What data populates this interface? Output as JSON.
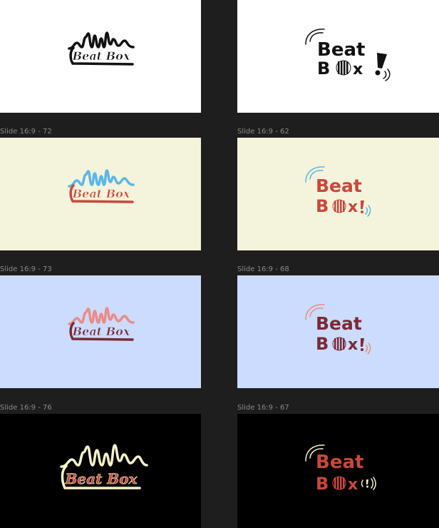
{
  "canvas": {
    "background": "#1e1e1e"
  },
  "frames": [
    {
      "id": "r1-left",
      "label": "",
      "bg": "#ffffff",
      "variant": "wave",
      "colors": {
        "wave": "#111111",
        "text": "#111111",
        "fill": "#111111",
        "line": "#111111"
      }
    },
    {
      "id": "r1-right",
      "label": "",
      "bg": "#ffffff",
      "variant": "beat",
      "colors": {
        "arc": "#111111",
        "text": "#111111",
        "ball": "#111111",
        "bang": "#111111",
        "waves": "#111111"
      }
    },
    {
      "id": "r2-left",
      "label": "Slide 16:9 - 72",
      "bg": "#f4f3dc",
      "variant": "wave",
      "colors": {
        "wave": "#5bb7e6",
        "text": "#c9483a",
        "fill": "#c9483a",
        "line": "#c9483a"
      }
    },
    {
      "id": "r2-right",
      "label": "Slide 16:9 - 62",
      "bg": "#f4f3dc",
      "variant": "beat",
      "colors": {
        "arc": "#5bb7e6",
        "text": "#c9483a",
        "ball": "#c9483a",
        "bang": "#c9483a",
        "waves": "#5bb7e6"
      }
    },
    {
      "id": "r3-left",
      "label": "Slide 16:9 - 73",
      "bg": "#cbdcff",
      "variant": "wave",
      "colors": {
        "wave": "#ec8b87",
        "text": "#7b2a35",
        "fill": "#7b2a35",
        "line": "#7b2a35"
      }
    },
    {
      "id": "r3-right",
      "label": "Slide 16:9 - 68",
      "bg": "#cbdcff",
      "variant": "beat",
      "colors": {
        "arc": "#ec8b87",
        "text": "#7b2a35",
        "ball": "#7b2a35",
        "bang": "#7b2a35",
        "waves": "#ec8b87"
      }
    },
    {
      "id": "r4-left",
      "label": "Slide 16:9 - 76",
      "bg": "#000000",
      "variant": "wave",
      "colors": {
        "wave": "#f6f2c9",
        "text": "#c9483a",
        "fill": "#c9483a",
        "line": "#f6f2c9"
      }
    },
    {
      "id": "r4-right",
      "label": "Slide 16:9 - 67",
      "bg": "#000000",
      "variant": "beat",
      "colors": {
        "arc": "#f6f2c9",
        "text": "#c9483a",
        "ball": "#c9483a",
        "bang": "#f6f2c9",
        "waves": "#f6f2c9"
      }
    }
  ],
  "logo": {
    "wave_text": "Beat Box",
    "beat_word": "Beat",
    "box_b": "B",
    "box_x": "x"
  }
}
